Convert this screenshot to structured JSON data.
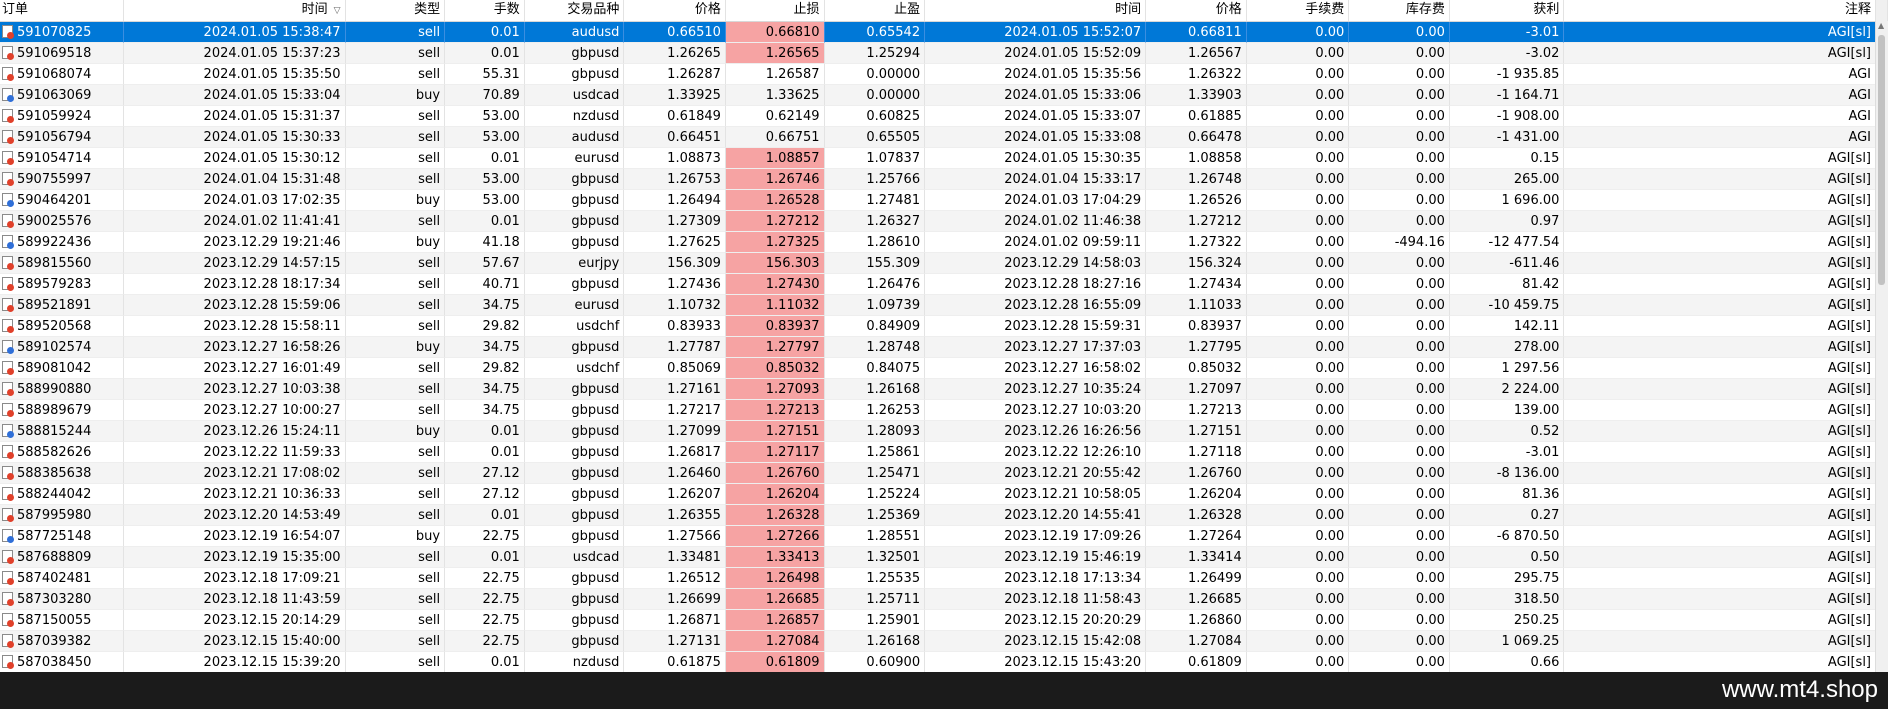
{
  "headers": [
    "订单",
    "时间",
    "类型",
    "手数",
    "交易品种",
    "价格",
    "止损",
    "止盈",
    "时间",
    "价格",
    "手续费",
    "库存费",
    "获利",
    "注释"
  ],
  "sort_indicator": "▽",
  "footer": {
    "watermark": "www.mt4.shop"
  },
  "colors": {
    "selected_row": "#0078d7",
    "sl_hit": "#f6a3a3",
    "sell_dot": "#e0402a",
    "buy_dot": "#2f6fd8"
  },
  "rows": [
    {
      "order": "591070825",
      "open_time": "2024.01.05 15:38:47",
      "type": "sell",
      "lots": "0.01",
      "symbol": "audusd",
      "open_price": "0.66510",
      "sl": "0.66810",
      "tp": "0.65542",
      "close_time": "2024.01.05 15:52:07",
      "close_price": "0.66811",
      "commission": "0.00",
      "swap": "0.00",
      "profit": "-3.01",
      "comment": "AGI[sl]",
      "sl_hit": true,
      "selected": true
    },
    {
      "order": "591069518",
      "open_time": "2024.01.05 15:37:23",
      "type": "sell",
      "lots": "0.01",
      "symbol": "gbpusd",
      "open_price": "1.26265",
      "sl": "1.26565",
      "tp": "1.25294",
      "close_time": "2024.01.05 15:52:09",
      "close_price": "1.26567",
      "commission": "0.00",
      "swap": "0.00",
      "profit": "-3.02",
      "comment": "AGI[sl]",
      "sl_hit": true
    },
    {
      "order": "591068074",
      "open_time": "2024.01.05 15:35:50",
      "type": "sell",
      "lots": "55.31",
      "symbol": "gbpusd",
      "open_price": "1.26287",
      "sl": "1.26587",
      "tp": "0.00000",
      "close_time": "2024.01.05 15:35:56",
      "close_price": "1.26322",
      "commission": "0.00",
      "swap": "0.00",
      "profit": "-1 935.85",
      "comment": "AGI",
      "sl_hit": false
    },
    {
      "order": "591063069",
      "open_time": "2024.01.05 15:33:04",
      "type": "buy",
      "lots": "70.89",
      "symbol": "usdcad",
      "open_price": "1.33925",
      "sl": "1.33625",
      "tp": "0.00000",
      "close_time": "2024.01.05 15:33:06",
      "close_price": "1.33903",
      "commission": "0.00",
      "swap": "0.00",
      "profit": "-1 164.71",
      "comment": "AGI",
      "sl_hit": false
    },
    {
      "order": "591059924",
      "open_time": "2024.01.05 15:31:37",
      "type": "sell",
      "lots": "53.00",
      "symbol": "nzdusd",
      "open_price": "0.61849",
      "sl": "0.62149",
      "tp": "0.60825",
      "close_time": "2024.01.05 15:33:07",
      "close_price": "0.61885",
      "commission": "0.00",
      "swap": "0.00",
      "profit": "-1 908.00",
      "comment": "AGI",
      "sl_hit": false
    },
    {
      "order": "591056794",
      "open_time": "2024.01.05 15:30:33",
      "type": "sell",
      "lots": "53.00",
      "symbol": "audusd",
      "open_price": "0.66451",
      "sl": "0.66751",
      "tp": "0.65505",
      "close_time": "2024.01.05 15:33:08",
      "close_price": "0.66478",
      "commission": "0.00",
      "swap": "0.00",
      "profit": "-1 431.00",
      "comment": "AGI",
      "sl_hit": false
    },
    {
      "order": "591054714",
      "open_time": "2024.01.05 15:30:12",
      "type": "sell",
      "lots": "0.01",
      "symbol": "eurusd",
      "open_price": "1.08873",
      "sl": "1.08857",
      "tp": "1.07837",
      "close_time": "2024.01.05 15:30:35",
      "close_price": "1.08858",
      "commission": "0.00",
      "swap": "0.00",
      "profit": "0.15",
      "comment": "AGI[sl]",
      "sl_hit": true
    },
    {
      "order": "590755997",
      "open_time": "2024.01.04 15:31:48",
      "type": "sell",
      "lots": "53.00",
      "symbol": "gbpusd",
      "open_price": "1.26753",
      "sl": "1.26746",
      "tp": "1.25766",
      "close_time": "2024.01.04 15:33:17",
      "close_price": "1.26748",
      "commission": "0.00",
      "swap": "0.00",
      "profit": "265.00",
      "comment": "AGI[sl]",
      "sl_hit": true
    },
    {
      "order": "590464201",
      "open_time": "2024.01.03 17:02:35",
      "type": "buy",
      "lots": "53.00",
      "symbol": "gbpusd",
      "open_price": "1.26494",
      "sl": "1.26528",
      "tp": "1.27481",
      "close_time": "2024.01.03 17:04:29",
      "close_price": "1.26526",
      "commission": "0.00",
      "swap": "0.00",
      "profit": "1 696.00",
      "comment": "AGI[sl]",
      "sl_hit": true
    },
    {
      "order": "590025576",
      "open_time": "2024.01.02 11:41:41",
      "type": "sell",
      "lots": "0.01",
      "symbol": "gbpusd",
      "open_price": "1.27309",
      "sl": "1.27212",
      "tp": "1.26327",
      "close_time": "2024.01.02 11:46:38",
      "close_price": "1.27212",
      "commission": "0.00",
      "swap": "0.00",
      "profit": "0.97",
      "comment": "AGI[sl]",
      "sl_hit": true
    },
    {
      "order": "589922436",
      "open_time": "2023.12.29 19:21:46",
      "type": "buy",
      "lots": "41.18",
      "symbol": "gbpusd",
      "open_price": "1.27625",
      "sl": "1.27325",
      "tp": "1.28610",
      "close_time": "2024.01.02 09:59:11",
      "close_price": "1.27322",
      "commission": "0.00",
      "swap": "-494.16",
      "profit": "-12 477.54",
      "comment": "AGI[sl]",
      "sl_hit": true
    },
    {
      "order": "589815560",
      "open_time": "2023.12.29 14:57:15",
      "type": "sell",
      "lots": "57.67",
      "symbol": "eurjpy",
      "open_price": "156.309",
      "sl": "156.303",
      "tp": "155.309",
      "close_time": "2023.12.29 14:58:03",
      "close_price": "156.324",
      "commission": "0.00",
      "swap": "0.00",
      "profit": "-611.46",
      "comment": "AGI[sl]",
      "sl_hit": true
    },
    {
      "order": "589579283",
      "open_time": "2023.12.28 18:17:34",
      "type": "sell",
      "lots": "40.71",
      "symbol": "gbpusd",
      "open_price": "1.27436",
      "sl": "1.27430",
      "tp": "1.26476",
      "close_time": "2023.12.28 18:27:16",
      "close_price": "1.27434",
      "commission": "0.00",
      "swap": "0.00",
      "profit": "81.42",
      "comment": "AGI[sl]",
      "sl_hit": true
    },
    {
      "order": "589521891",
      "open_time": "2023.12.28 15:59:06",
      "type": "sell",
      "lots": "34.75",
      "symbol": "eurusd",
      "open_price": "1.10732",
      "sl": "1.11032",
      "tp": "1.09739",
      "close_time": "2023.12.28 16:55:09",
      "close_price": "1.11033",
      "commission": "0.00",
      "swap": "0.00",
      "profit": "-10 459.75",
      "comment": "AGI[sl]",
      "sl_hit": true
    },
    {
      "order": "589520568",
      "open_time": "2023.12.28 15:58:11",
      "type": "sell",
      "lots": "29.82",
      "symbol": "usdchf",
      "open_price": "0.83933",
      "sl": "0.83937",
      "tp": "0.84909",
      "close_time": "2023.12.28 15:59:31",
      "close_price": "0.83937",
      "commission": "0.00",
      "swap": "0.00",
      "profit": "142.11",
      "comment": "AGI[sl]",
      "sl_hit": true
    },
    {
      "order": "589102574",
      "open_time": "2023.12.27 16:58:26",
      "type": "buy",
      "lots": "34.75",
      "symbol": "gbpusd",
      "open_price": "1.27787",
      "sl": "1.27797",
      "tp": "1.28748",
      "close_time": "2023.12.27 17:37:03",
      "close_price": "1.27795",
      "commission": "0.00",
      "swap": "0.00",
      "profit": "278.00",
      "comment": "AGI[sl]",
      "sl_hit": true
    },
    {
      "order": "589081042",
      "open_time": "2023.12.27 16:01:49",
      "type": "sell",
      "lots": "29.82",
      "symbol": "usdchf",
      "open_price": "0.85069",
      "sl": "0.85032",
      "tp": "0.84075",
      "close_time": "2023.12.27 16:58:02",
      "close_price": "0.85032",
      "commission": "0.00",
      "swap": "0.00",
      "profit": "1 297.56",
      "comment": "AGI[sl]",
      "sl_hit": true
    },
    {
      "order": "588990880",
      "open_time": "2023.12.27 10:03:38",
      "type": "sell",
      "lots": "34.75",
      "symbol": "gbpusd",
      "open_price": "1.27161",
      "sl": "1.27093",
      "tp": "1.26168",
      "close_time": "2023.12.27 10:35:24",
      "close_price": "1.27097",
      "commission": "0.00",
      "swap": "0.00",
      "profit": "2 224.00",
      "comment": "AGI[sl]",
      "sl_hit": true
    },
    {
      "order": "588989679",
      "open_time": "2023.12.27 10:00:27",
      "type": "sell",
      "lots": "34.75",
      "symbol": "gbpusd",
      "open_price": "1.27217",
      "sl": "1.27213",
      "tp": "1.26253",
      "close_time": "2023.12.27 10:03:20",
      "close_price": "1.27213",
      "commission": "0.00",
      "swap": "0.00",
      "profit": "139.00",
      "comment": "AGI[sl]",
      "sl_hit": true
    },
    {
      "order": "588815244",
      "open_time": "2023.12.26 15:24:11",
      "type": "buy",
      "lots": "0.01",
      "symbol": "gbpusd",
      "open_price": "1.27099",
      "sl": "1.27151",
      "tp": "1.28093",
      "close_time": "2023.12.26 16:26:56",
      "close_price": "1.27151",
      "commission": "0.00",
      "swap": "0.00",
      "profit": "0.52",
      "comment": "AGI[sl]",
      "sl_hit": true
    },
    {
      "order": "588582626",
      "open_time": "2023.12.22 11:59:33",
      "type": "sell",
      "lots": "0.01",
      "symbol": "gbpusd",
      "open_price": "1.26817",
      "sl": "1.27117",
      "tp": "1.25861",
      "close_time": "2023.12.22 12:26:10",
      "close_price": "1.27118",
      "commission": "0.00",
      "swap": "0.00",
      "profit": "-3.01",
      "comment": "AGI[sl]",
      "sl_hit": true
    },
    {
      "order": "588385638",
      "open_time": "2023.12.21 17:08:02",
      "type": "sell",
      "lots": "27.12",
      "symbol": "gbpusd",
      "open_price": "1.26460",
      "sl": "1.26760",
      "tp": "1.25471",
      "close_time": "2023.12.21 20:55:42",
      "close_price": "1.26760",
      "commission": "0.00",
      "swap": "0.00",
      "profit": "-8 136.00",
      "comment": "AGI[sl]",
      "sl_hit": true
    },
    {
      "order": "588244042",
      "open_time": "2023.12.21 10:36:33",
      "type": "sell",
      "lots": "27.12",
      "symbol": "gbpusd",
      "open_price": "1.26207",
      "sl": "1.26204",
      "tp": "1.25224",
      "close_time": "2023.12.21 10:58:05",
      "close_price": "1.26204",
      "commission": "0.00",
      "swap": "0.00",
      "profit": "81.36",
      "comment": "AGI[sl]",
      "sl_hit": true
    },
    {
      "order": "587995980",
      "open_time": "2023.12.20 14:53:49",
      "type": "sell",
      "lots": "0.01",
      "symbol": "gbpusd",
      "open_price": "1.26355",
      "sl": "1.26328",
      "tp": "1.25369",
      "close_time": "2023.12.20 14:55:41",
      "close_price": "1.26328",
      "commission": "0.00",
      "swap": "0.00",
      "profit": "0.27",
      "comment": "AGI[sl]",
      "sl_hit": true
    },
    {
      "order": "587725148",
      "open_time": "2023.12.19 16:54:07",
      "type": "buy",
      "lots": "22.75",
      "symbol": "gbpusd",
      "open_price": "1.27566",
      "sl": "1.27266",
      "tp": "1.28551",
      "close_time": "2023.12.19 17:09:26",
      "close_price": "1.27264",
      "commission": "0.00",
      "swap": "0.00",
      "profit": "-6 870.50",
      "comment": "AGI[sl]",
      "sl_hit": true
    },
    {
      "order": "587688809",
      "open_time": "2023.12.19 15:35:00",
      "type": "sell",
      "lots": "0.01",
      "symbol": "usdcad",
      "open_price": "1.33481",
      "sl": "1.33413",
      "tp": "1.32501",
      "close_time": "2023.12.19 15:46:19",
      "close_price": "1.33414",
      "commission": "0.00",
      "swap": "0.00",
      "profit": "0.50",
      "comment": "AGI[sl]",
      "sl_hit": true
    },
    {
      "order": "587402481",
      "open_time": "2023.12.18 17:09:21",
      "type": "sell",
      "lots": "22.75",
      "symbol": "gbpusd",
      "open_price": "1.26512",
      "sl": "1.26498",
      "tp": "1.25535",
      "close_time": "2023.12.18 17:13:34",
      "close_price": "1.26499",
      "commission": "0.00",
      "swap": "0.00",
      "profit": "295.75",
      "comment": "AGI[sl]",
      "sl_hit": true
    },
    {
      "order": "587303280",
      "open_time": "2023.12.18 11:43:59",
      "type": "sell",
      "lots": "22.75",
      "symbol": "gbpusd",
      "open_price": "1.26699",
      "sl": "1.26685",
      "tp": "1.25711",
      "close_time": "2023.12.18 11:58:43",
      "close_price": "1.26685",
      "commission": "0.00",
      "swap": "0.00",
      "profit": "318.50",
      "comment": "AGI[sl]",
      "sl_hit": true
    },
    {
      "order": "587150055",
      "open_time": "2023.12.15 20:14:29",
      "type": "sell",
      "lots": "22.75",
      "symbol": "gbpusd",
      "open_price": "1.26871",
      "sl": "1.26857",
      "tp": "1.25901",
      "close_time": "2023.12.15 20:20:29",
      "close_price": "1.26860",
      "commission": "0.00",
      "swap": "0.00",
      "profit": "250.25",
      "comment": "AGI[sl]",
      "sl_hit": true
    },
    {
      "order": "587039382",
      "open_time": "2023.12.15 15:40:00",
      "type": "sell",
      "lots": "22.75",
      "symbol": "gbpusd",
      "open_price": "1.27131",
      "sl": "1.27084",
      "tp": "1.26168",
      "close_time": "2023.12.15 15:42:08",
      "close_price": "1.27084",
      "commission": "0.00",
      "swap": "0.00",
      "profit": "1 069.25",
      "comment": "AGI[sl]",
      "sl_hit": true
    },
    {
      "order": "587038450",
      "open_time": "2023.12.15 15:39:20",
      "type": "sell",
      "lots": "0.01",
      "symbol": "nzdusd",
      "open_price": "0.61875",
      "sl": "0.61809",
      "tp": "0.60900",
      "close_time": "2023.12.15 15:43:20",
      "close_price": "0.61809",
      "commission": "0.00",
      "swap": "0.00",
      "profit": "0.66",
      "comment": "AGI[sl]",
      "sl_hit": true
    }
  ]
}
